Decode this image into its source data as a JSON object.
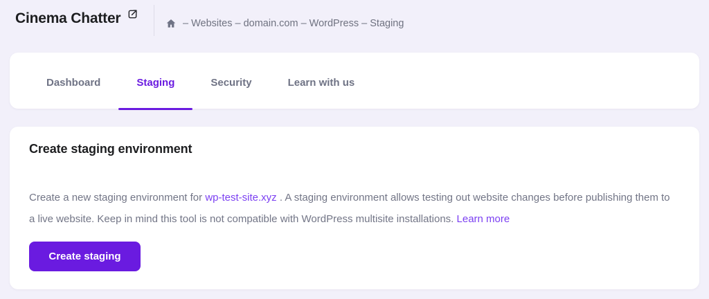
{
  "header": {
    "site_title": "Cinema Chatter",
    "breadcrumb_text": "– Websites – domain.com – WordPress – Staging"
  },
  "tabs": {
    "items": [
      {
        "label": "Dashboard",
        "active": false
      },
      {
        "label": "Staging",
        "active": true
      },
      {
        "label": "Security",
        "active": false
      },
      {
        "label": "Learn with us",
        "active": false
      }
    ]
  },
  "staging": {
    "title": "Create staging environment",
    "description_before_link": "Create a new staging environment for",
    "site_link": "wp-test-site.xyz",
    "description_after_link": ". A staging environment allows testing out website changes before publishing them to a live website. Keep in mind this tool is not compatible with WordPress multisite installations.",
    "learn_more": "Learn more",
    "create_button": "Create staging"
  },
  "icons": {
    "external_link": "open-in-new-icon",
    "home": "home-icon"
  },
  "colors": {
    "primary_purple": "#6a1be0",
    "link_purple": "#7b3ff2",
    "text_dark": "#1d1e20",
    "text_gray": "#727586",
    "tab_gray": "#6f7385",
    "page_background": "#f2f0fa",
    "card_background": "#ffffff"
  }
}
